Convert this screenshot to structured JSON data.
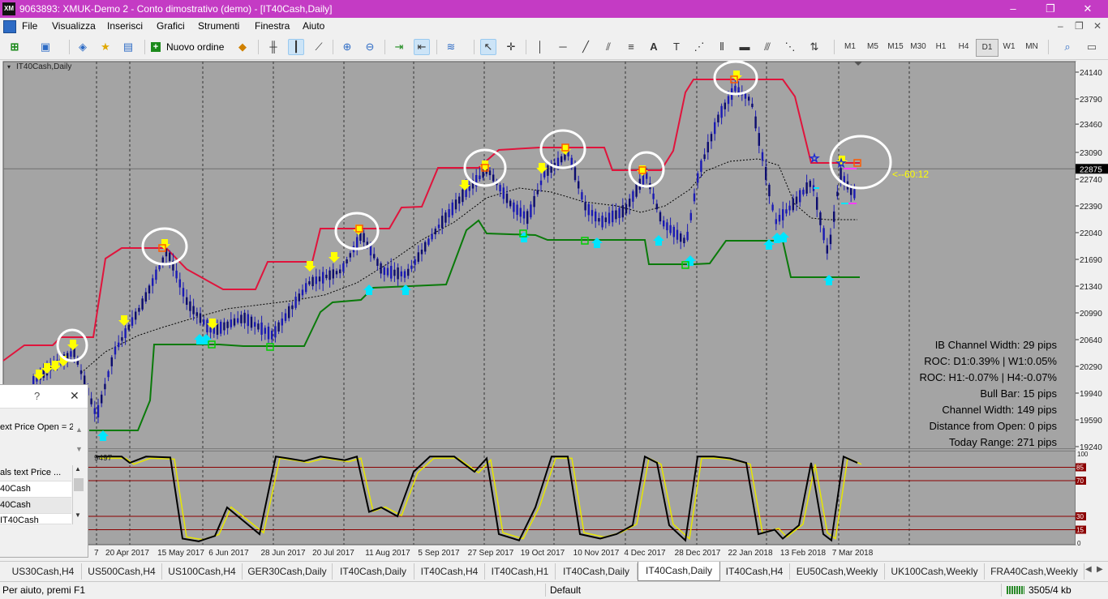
{
  "window": {
    "title": "9063893: XMUK-Demo 2 - Conto dimostrativo (demo) - [IT40Cash,Daily]",
    "logo": "XM",
    "minimize_icon": "–",
    "restore_icon": "❐",
    "close_icon": "✕"
  },
  "menu": [
    "File",
    "Visualizza",
    "Inserisci",
    "Grafici",
    "Strumenti",
    "Finestra",
    "Aiuto"
  ],
  "mdi_controls": [
    "–",
    "❐",
    "✕"
  ],
  "toolbar": {
    "new_order_label": "Nuovo ordine",
    "timeframes": [
      "M1",
      "M5",
      "M15",
      "M30",
      "H1",
      "H4",
      "D1",
      "W1",
      "MN"
    ],
    "active_timeframe": "D1"
  },
  "chart": {
    "symbol_label": "IT40Cash,Daily",
    "price_ticks": [
      "24140",
      "23790",
      "23460",
      "23090",
      "22740",
      "22390",
      "22040",
      "21690",
      "21340",
      "20990",
      "20640",
      "20290",
      "19940",
      "19590",
      "19240"
    ],
    "current_price": "22875",
    "countdown": "<--60:12",
    "date_ticks": [
      "7",
      "20 Apr 2017",
      "15 May 2017",
      "6 Jun 2017",
      "28 Jun 2017",
      "20 Jul 2017",
      "11 Aug 2017",
      "5 Sep 2017",
      "27 Sep 2017",
      "19 Oct 2017",
      "10 Nov 2017",
      "4 Dec 2017",
      "28 Dec 2017",
      "22 Jan 2018",
      "13 Feb 2018",
      "7 Mar 2018"
    ],
    "info_lines": [
      "IB Channel Width: 29 pips",
      "ROC: D1:0.39% | W1:0.05%",
      "ROC: H1:-0.07% | H4:-0.07%",
      "Bull Bar: 15 pips",
      "Channel Width: 149 pips",
      "Distance from Open:  0 pips",
      "Today Range:  271 pips"
    ],
    "osc_label": "9497",
    "osc_levels": [
      "100",
      "85",
      "70",
      "30",
      "15",
      "0"
    ],
    "colors": {
      "background": "#a4a4a4",
      "upper_channel": "#e0143c",
      "lower_channel": "#0a7a0a",
      "mid_line": "#000000",
      "candles": "#1a1ab4",
      "arrow_down": "#ffff00",
      "arrow_up": "#00e5ff",
      "highlight_circle": "#ffffff",
      "osc_main": "#000000",
      "osc_signal": "#e6e600",
      "osc_level": "#8b0000"
    }
  },
  "panel": {
    "help_icon": "?",
    "close_icon": "✕",
    "text1": "ext Price Open = 2",
    "list_header": "als text Price ...",
    "list_items": [
      "40Cash",
      "40Cash",
      "IT40Cash"
    ]
  },
  "tabs": [
    "US30Cash,H4",
    "US500Cash,H4",
    "US100Cash,H4",
    "GER30Cash,Daily",
    "IT40Cash,Daily",
    "IT40Cash,H4",
    "IT40Cash,H1",
    "IT40Cash,Daily",
    "IT40Cash,Daily",
    "IT40Cash,H4",
    "EU50Cash,Weekly",
    "UK100Cash,Weekly",
    "FRA40Cash,Weekly"
  ],
  "active_tab_index": 8,
  "status": {
    "help": "Per aiuto, premi F1",
    "profile": "Default",
    "traffic": "3505/4 kb"
  }
}
